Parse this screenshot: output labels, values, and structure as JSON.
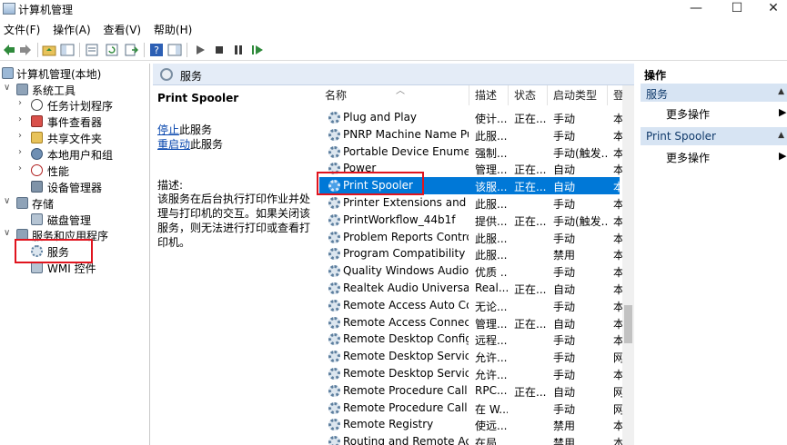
{
  "window": {
    "title": "计算机管理",
    "minimize": "—",
    "maximize": "☐",
    "close": "✕"
  },
  "menu": [
    "文件(F)",
    "操作(A)",
    "查看(V)",
    "帮助(H)"
  ],
  "tree": {
    "root": "计算机管理(本地)",
    "system_tools": "系统工具",
    "task_scheduler": "任务计划程序",
    "event_viewer": "事件查看器",
    "shared_folders": "共享文件夹",
    "local_users": "本地用户和组",
    "performance": "性能",
    "device_manager": "设备管理器",
    "storage": "存储",
    "disk_management": "磁盘管理",
    "services_apps": "服务和应用程序",
    "services": "服务",
    "wmi": "WMI 控件"
  },
  "services_panel": {
    "header": "服务",
    "detail": {
      "title": "Print Spooler",
      "stop_link": "停止",
      "stop_suffix": "此服务",
      "restart_link": "重启动",
      "restart_suffix": "此服务",
      "desc_label": "描述:",
      "desc_text": "该服务在后台执行打印作业并处理与打印机的交互。如果关闭该服务，则无法进行打印或查看打印机。"
    },
    "columns": {
      "name": "名称",
      "desc": "描述",
      "status": "状态",
      "startup": "启动类型",
      "logon": "登"
    },
    "rows": [
      {
        "name": "Plug and Play",
        "desc": "使计...",
        "status": "正在...",
        "startup": "手动",
        "logon": "本"
      },
      {
        "name": "PNRP Machine Name Pu...",
        "desc": "此服...",
        "status": "",
        "startup": "手动",
        "logon": "本"
      },
      {
        "name": "Portable Device Enumera...",
        "desc": "强制...",
        "status": "",
        "startup": "手动(触发...",
        "logon": "本"
      },
      {
        "name": "Power",
        "desc": "管理...",
        "status": "正在...",
        "startup": "自动",
        "logon": "本"
      },
      {
        "name": "Print Spooler",
        "desc": "该服...",
        "status": "正在...",
        "startup": "自动",
        "logon": "本"
      },
      {
        "name": "Printer Extensions and N...",
        "desc": "此服...",
        "status": "",
        "startup": "手动",
        "logon": "本"
      },
      {
        "name": "PrintWorkflow_44b1f",
        "desc": "提供...",
        "status": "正在...",
        "startup": "手动(触发...",
        "logon": "本"
      },
      {
        "name": "Problem Reports Control...",
        "desc": "此服...",
        "status": "",
        "startup": "手动",
        "logon": "本"
      },
      {
        "name": "Program Compatibility A...",
        "desc": "此服...",
        "status": "",
        "startup": "禁用",
        "logon": "本"
      },
      {
        "name": "Quality Windows Audio V...",
        "desc": "优质 ...",
        "status": "",
        "startup": "手动",
        "logon": "本"
      },
      {
        "name": "Realtek Audio Universal ...",
        "desc": "Real...",
        "status": "正在...",
        "startup": "自动",
        "logon": "本"
      },
      {
        "name": "Remote Access Auto Con...",
        "desc": "无论...",
        "status": "",
        "startup": "手动",
        "logon": "本"
      },
      {
        "name": "Remote Access Connecti...",
        "desc": "管理...",
        "status": "正在...",
        "startup": "自动",
        "logon": "本"
      },
      {
        "name": "Remote Desktop Configu...",
        "desc": "远程...",
        "status": "",
        "startup": "手动",
        "logon": "本"
      },
      {
        "name": "Remote Desktop Services",
        "desc": "允许...",
        "status": "",
        "startup": "手动",
        "logon": "网"
      },
      {
        "name": "Remote Desktop Service...",
        "desc": "允许...",
        "status": "",
        "startup": "手动",
        "logon": "本"
      },
      {
        "name": "Remote Procedure Call (...",
        "desc": "RPC...",
        "status": "正在...",
        "startup": "自动",
        "logon": "网"
      },
      {
        "name": "Remote Procedure Call (...",
        "desc": "在 W...",
        "status": "",
        "startup": "手动",
        "logon": "网"
      },
      {
        "name": "Remote Registry",
        "desc": "使远...",
        "status": "",
        "startup": "禁用",
        "logon": "本"
      },
      {
        "name": "Routing and Remote Acc...",
        "desc": "在局...",
        "status": "",
        "startup": "禁用",
        "logon": "本"
      }
    ]
  },
  "actions": {
    "header": "操作",
    "section1": "服务",
    "more1": "更多操作",
    "section2": "Print Spooler",
    "more2": "更多操作"
  },
  "colors": {
    "selection": "#0078d7",
    "highlight": "#e0141e",
    "link": "#0645ad"
  }
}
